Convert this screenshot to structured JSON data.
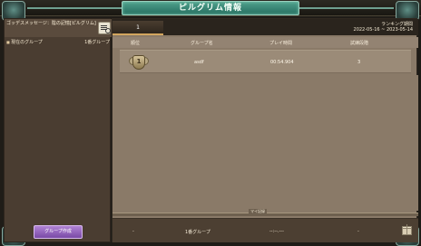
{
  "window": {
    "title": "ピルグリム情報"
  },
  "left_panel": {
    "message": "ゴッデスメッセージ：陰の記憶[ピルグリム]",
    "current_group_label": "現在のグループ",
    "current_group_value": "1番グループ",
    "create_group_button": "グループ作成"
  },
  "right_panel": {
    "tab_label": "1",
    "ranking_period_label": "ランキング期間",
    "ranking_period_dates": "2022-05-16 ~ 2023-05-14",
    "columns": [
      "順位",
      "グループ名",
      "プレイ時間",
      "試練段階"
    ],
    "rows": [
      {
        "rank": "1",
        "group_name": "asdf",
        "play_time": "00:54.904",
        "trial_stage": "3"
      }
    ],
    "divider_label": "マイ記録",
    "my_record": {
      "rank": "-",
      "group_name": "1番グループ",
      "play_time": "--:--.---",
      "trial_stage": "-"
    }
  },
  "icons": [
    "message-list-icon",
    "rank-badge-icon",
    "gift-icon"
  ]
}
